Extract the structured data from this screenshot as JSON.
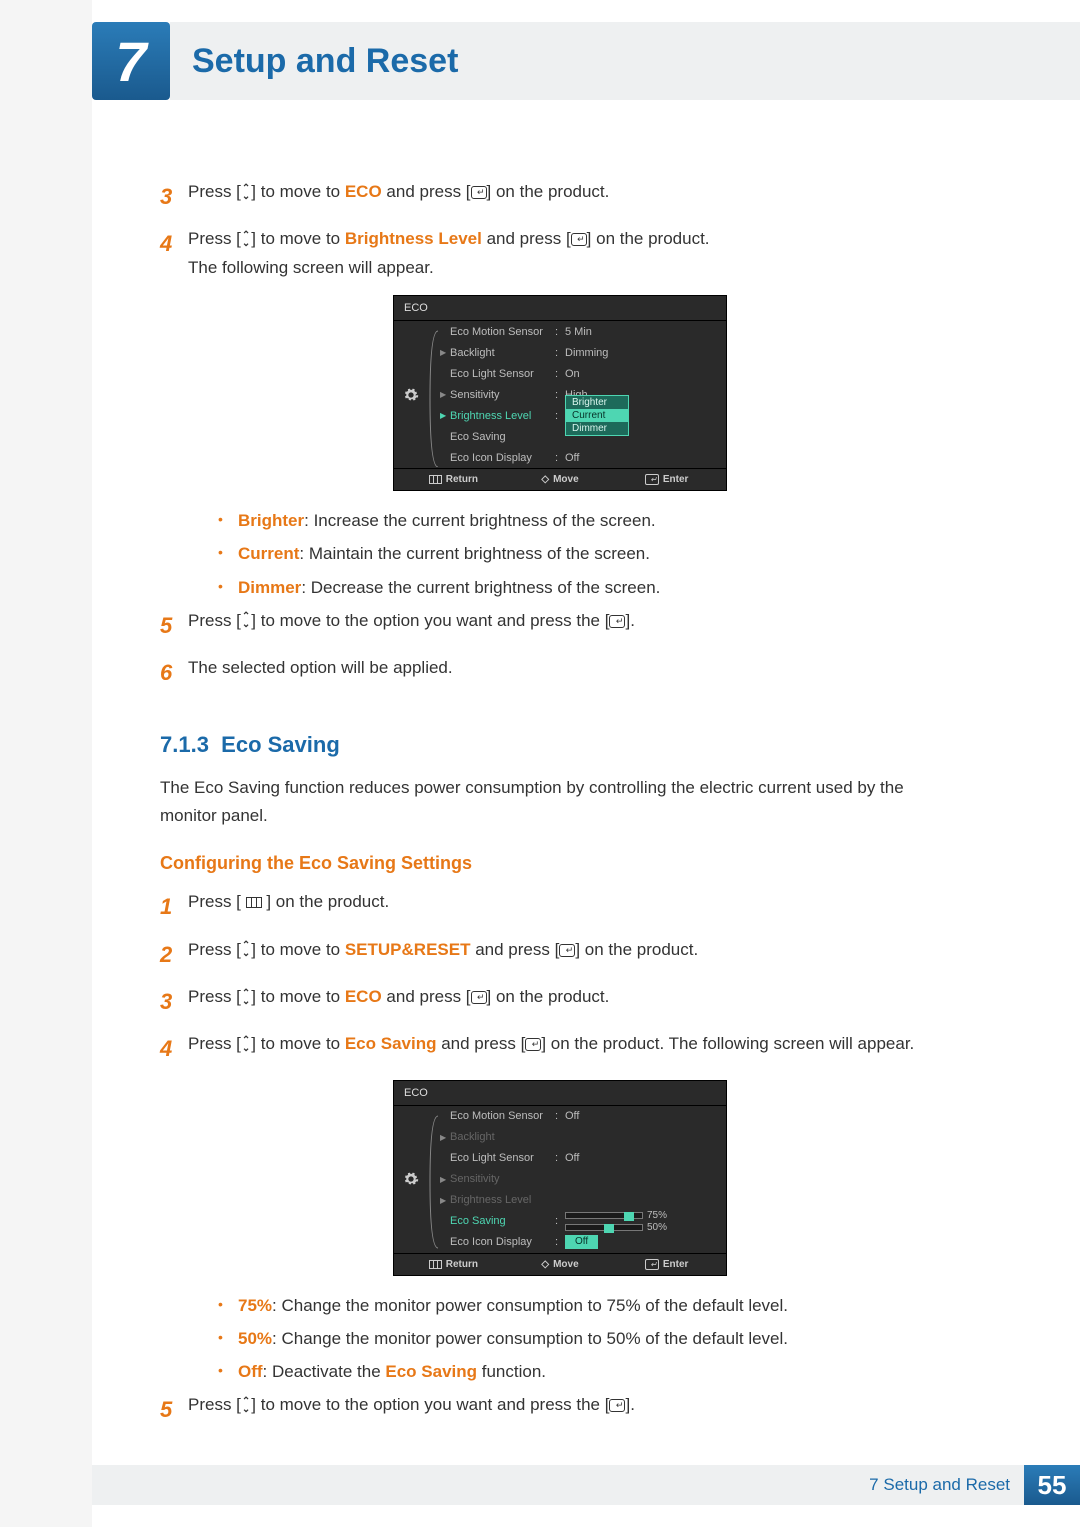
{
  "header": {
    "chapter_number": "7",
    "title": "Setup and Reset"
  },
  "icons": {
    "updown": "⌃⌄",
    "enter_glyph": "↵",
    "move_glyph": "◇"
  },
  "steps_a": [
    {
      "num": "3",
      "pre": "Press [",
      "icon": "updown",
      "mid1": "] to move to ",
      "bold": "ECO",
      "mid2": " and press [",
      "icon2": "enter",
      "post": "] on the product."
    },
    {
      "num": "4",
      "pre": "Press [",
      "icon": "updown",
      "mid1": "] to move to ",
      "bold": "Brightness Level",
      "mid2": " and press [",
      "icon2": "enter",
      "post": "] on the product."
    }
  ],
  "step4_line2": "The following screen will appear.",
  "osd1": {
    "title": "ECO",
    "rows": [
      {
        "label": "Eco Motion Sensor",
        "value": "5 Min"
      },
      {
        "label": "Backlight",
        "tri": true,
        "value": "Dimming"
      },
      {
        "label": "Eco Light Sensor",
        "value": "On"
      },
      {
        "label": "Sensitivity",
        "tri": true,
        "value": "High"
      },
      {
        "label": "Brightness Level",
        "tri": true,
        "highlight": true,
        "dropdown": [
          "Brighter",
          "Current",
          "Dimmer"
        ],
        "selected": 1
      },
      {
        "label": "Eco Saving"
      },
      {
        "label": "Eco Icon Display",
        "value": "Off"
      }
    ],
    "footer": {
      "return": "Return",
      "move": "Move",
      "enter": "Enter"
    }
  },
  "bullets1": [
    {
      "bold": "Brighter",
      "text": ": Increase the current brightness of the screen."
    },
    {
      "bold": "Current",
      "text": ": Maintain the current brightness of the screen."
    },
    {
      "bold": "Dimmer",
      "text": ": Decrease the current brightness of the screen."
    }
  ],
  "steps_b": [
    {
      "num": "5",
      "pre": "Press [",
      "icon": "updown",
      "mid1": "] to move to the option you want and press the [",
      "icon2": "enter",
      "post": "]."
    },
    {
      "num": "6",
      "plain": "The selected option will be applied."
    }
  ],
  "section713": {
    "num": "7.1.3",
    "title": "Eco Saving",
    "intro": "The Eco Saving function reduces power consumption by controlling the electric current used by the monitor panel.",
    "subhead": "Configuring the Eco Saving Settings"
  },
  "steps_c": [
    {
      "num": "1",
      "pre": "Press [ ",
      "icon": "menu",
      "post": " ] on the product."
    },
    {
      "num": "2",
      "pre": "Press [",
      "icon": "updown",
      "mid1": "] to move to ",
      "bold": "SETUP&RESET",
      "mid2": " and press [",
      "icon2": "enter",
      "post": "] on the product."
    },
    {
      "num": "3",
      "pre": "Press [",
      "icon": "updown",
      "mid1": "] to move to ",
      "bold": "ECO",
      "mid2": " and press [",
      "icon2": "enter",
      "post": "] on the product."
    },
    {
      "num": "4",
      "pre": "Press [",
      "icon": "updown",
      "mid1": "] to move to ",
      "bold": "Eco Saving",
      "mid2": " and press [",
      "icon2": "enter",
      "post": "] on the product. The following screen will appear."
    }
  ],
  "osd2": {
    "title": "ECO",
    "rows": [
      {
        "label": "Eco Motion Sensor",
        "value": "Off"
      },
      {
        "label": "Backlight",
        "tri": true,
        "dim": true
      },
      {
        "label": "Eco Light Sensor",
        "value": "Off"
      },
      {
        "label": "Sensitivity",
        "tri": true,
        "dim": true
      },
      {
        "label": "Brightness Level",
        "tri": true,
        "dim": true
      },
      {
        "label": "Eco Saving",
        "highlight": true,
        "sliders": [
          {
            "pct": "75%",
            "pos": 58
          },
          {
            "pct": "50%",
            "pos": 38
          }
        ],
        "selected_pill": "Off"
      },
      {
        "label": "Eco Icon Display"
      }
    ],
    "footer": {
      "return": "Return",
      "move": "Move",
      "enter": "Enter"
    }
  },
  "bullets2": [
    {
      "bold": "75%",
      "text": ": Change the monitor power consumption to 75% of the default level."
    },
    {
      "bold": "50%",
      "text": ": Change the monitor power consumption to 50% of the default level."
    },
    {
      "bold": "Off",
      "text1": ": Deactivate the ",
      "bold2": "Eco Saving",
      "text2": " function."
    }
  ],
  "step5b": {
    "num": "5",
    "pre": "Press [",
    "icon": "updown",
    "mid1": "] to move to the option you want and press the [",
    "icon2": "enter",
    "post": "]."
  },
  "footer": {
    "label": "7 Setup and Reset",
    "page": "55"
  }
}
